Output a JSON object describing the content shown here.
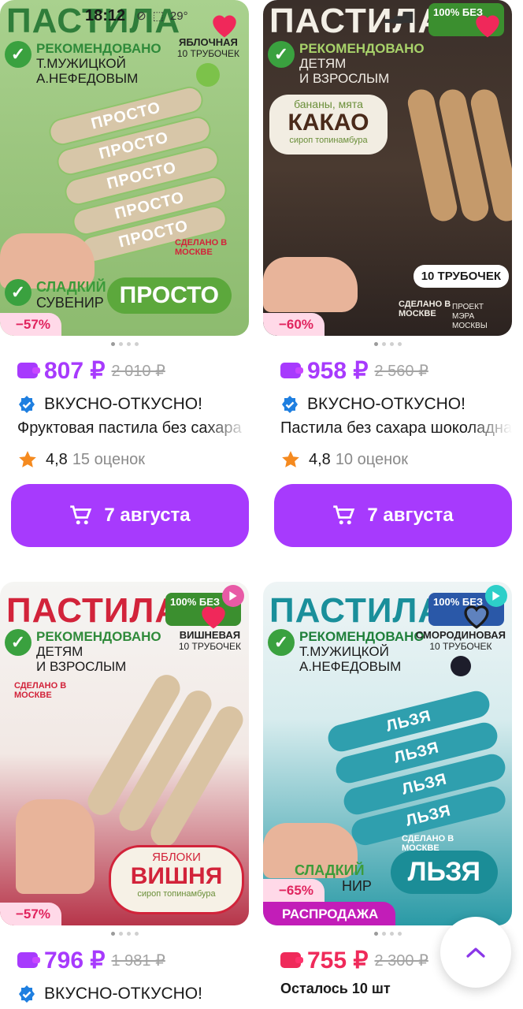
{
  "status_bar": {
    "time": "18:12",
    "temperature": "29°",
    "icons": [
      "navigation-icon",
      "wb-app-icon",
      "wifi-icon",
      "signal-icon"
    ]
  },
  "accent_color": "#a73afd",
  "products": [
    {
      "image": {
        "brand": "ПАСТИЛА",
        "rec_line1": "РЕКОМЕНДОВАНО",
        "rec_line2": "Т.МУЖИЦКОЙ",
        "rec_line3": "А.НЕФЕДОВЫМ",
        "flavor": "ЯБЛОЧНАЯ",
        "flavor_sub": "10 ТРУБОЧЕК",
        "roll_text": "ПРОСТО",
        "made_in": "СДЕЛАНО В МОСКВЕ",
        "sweet_line1": "СЛАДКИЙ",
        "sweet_line2": "СУВЕНИР",
        "tag": "ПРОСТО"
      },
      "discount": "−57%",
      "favorite": true,
      "price": "807 ₽",
      "old_price": "2 010 ₽",
      "seller": "ВКУСНО-ОТКУСНО!",
      "name": "Фруктовая пастила без сахара",
      "rating": "4,8",
      "reviews": "15 оценок",
      "delivery": "7 августа"
    },
    {
      "image": {
        "brand": "ПАСТИЛА",
        "badge": "100% БЕЗ",
        "rec_line1": "РЕКОМЕНДОВАНО",
        "rec_line2": "ДЕТЯМ",
        "rec_line3": "И ВЗРОСЛЫМ",
        "flavor_top": "бананы, мята",
        "flavor_main": "КАКАО",
        "flavor_sub": "сироп топинамбура",
        "count": "10 ТРУБОЧЕК",
        "made_in": "СДЕЛАНО В МОСКВЕ",
        "project": "ПРОЕКТ МЭРА МОСКВЫ"
      },
      "discount": "−60%",
      "favorite": true,
      "price": "958 ₽",
      "old_price": "2 560 ₽",
      "seller": "ВКУСНО-ОТКУСНО!",
      "name": "Пастила без сахара шоколадная",
      "rating": "4,8",
      "reviews": "10 оценок",
      "delivery": "7 августа"
    },
    {
      "image": {
        "brand": "ПАСТИЛА",
        "badge": "100% БЕЗ",
        "rec_line1": "РЕКОМЕНДОВАНО",
        "rec_line2": "ДЕТЯМ",
        "rec_line3": "И ВЗРОСЛЫМ",
        "flavor": "ВИШНЕВАЯ",
        "flavor_sub": "10 ТРУБОЧЕК",
        "made_in": "СДЕЛАНО В МОСКВЕ",
        "label_top": "ЯБЛОКИ",
        "label_main": "ВИШНЯ",
        "label_sub": "сироп топинамбура"
      },
      "discount": "−57%",
      "favorite": true,
      "price": "796 ₽",
      "old_price": "1 981 ₽",
      "seller": "ВКУСНО-ОТКУСНО!"
    },
    {
      "image": {
        "brand": "ПАСТИЛА",
        "badge": "100% БЕЗ",
        "rec_line1": "РЕКОМЕНДОВАНО",
        "rec_line2": "Т.МУЖИЦКОЙ",
        "rec_line3": "А.НЕФЕДОВЫМ",
        "flavor": "СМОРОДИНОВАЯ",
        "flavor_sub": "10 ТРУБОЧЕК",
        "roll_text": "ЛЬЗЯ",
        "made_in": "СДЕЛАНО В МОСКВЕ",
        "sweet_line1": "СЛАДКИЙ",
        "sweet_line2": "НИР",
        "tag": "ЛЬЗЯ"
      },
      "discount": "−65%",
      "sale_label": "РАСПРОДАЖА",
      "favorite": false,
      "price": "755 ₽",
      "old_price": "2 300 ₽",
      "stock": "Осталось 10 шт"
    }
  ]
}
